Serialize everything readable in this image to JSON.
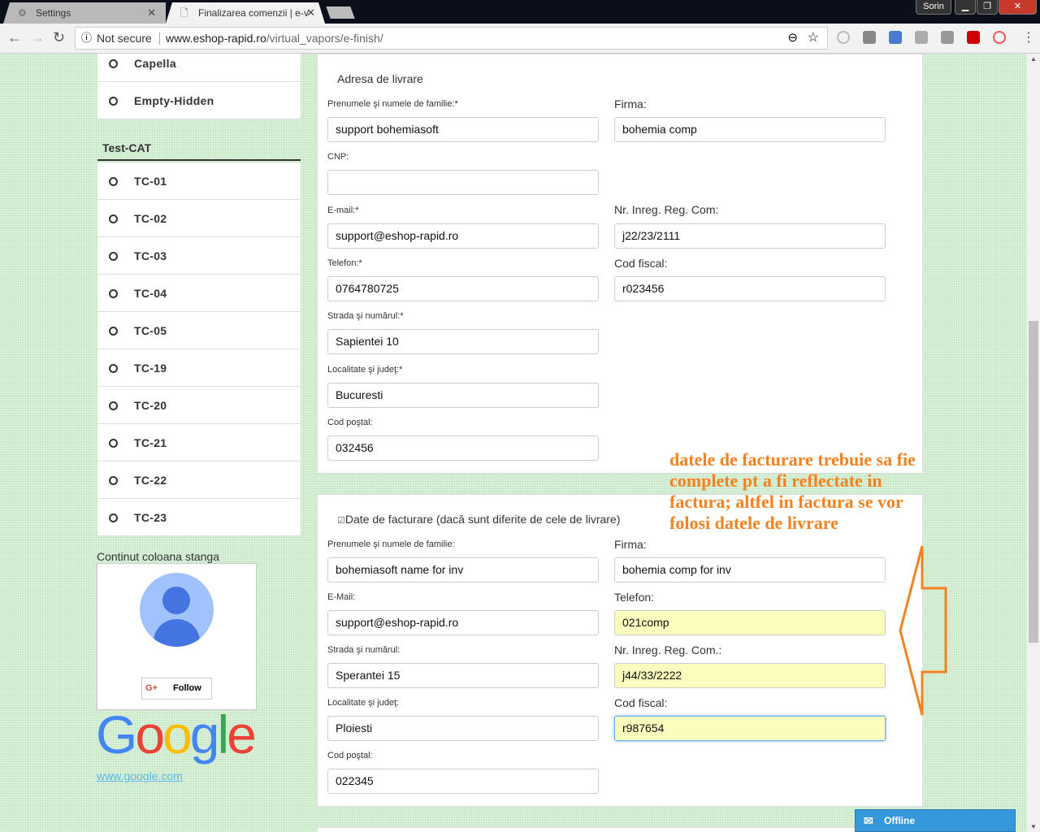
{
  "browser": {
    "tabs": [
      {
        "label": "Settings",
        "icon": "gear-icon"
      },
      {
        "label": "Finalizarea comenzii | e-v",
        "icon": "page-icon"
      }
    ],
    "user": "Sorin",
    "security": "Not secure",
    "url_host": "www.eshop-rapid.ro",
    "url_path": "/virtual_vapors/e-finish/"
  },
  "sidebar": {
    "top_items": [
      "Capella",
      "Empty-Hidden"
    ],
    "category": "Test-CAT",
    "items": [
      "TC-01",
      "TC-02",
      "TC-03",
      "TC-04",
      "TC-05",
      "TC-19",
      "TC-20",
      "TC-21",
      "TC-22",
      "TC-23"
    ],
    "widget_title": "Continut coloana stanga",
    "follow": "Follow",
    "google_logo": "Google",
    "google_link": "www.google.com"
  },
  "delivery": {
    "title": "Adresa de livrare",
    "name_label": "Prenumele şi numele de familie:*",
    "name": "support bohemiasoft",
    "company_label": "Firma:",
    "company": "bohemia comp",
    "cnp_label": "CNP:",
    "cnp": "",
    "email_label": "E-mail:*",
    "email": "support@eshop-rapid.ro",
    "reg_label": "Nr. Inreg. Reg. Com:",
    "reg": "j22/23/2111",
    "phone_label": "Telefon:*",
    "phone": "0764780725",
    "fiscal_label": "Cod fiscal:",
    "fiscal": "r023456",
    "street_label": "Strada şi numărul:*",
    "street": "Sapientei 10",
    "city_label": "Localitate şi judeţ:*",
    "city": "Bucuresti",
    "zip_label": "Cod poştal:",
    "zip": "032456"
  },
  "billing": {
    "checkbox_label": "Date de facturare (dacă sunt diferite de cele de livrare)",
    "checked": true,
    "name_label": "Prenumele şi numele de familie:",
    "name": "bohemiasoft name for inv",
    "company_label": "Firma:",
    "company": "bohemia comp for inv",
    "email_label": "E-Mail:",
    "email": "support@eshop-rapid.ro",
    "phone_label": "Telefon:",
    "phone": "021comp",
    "street_label": "Strada şi numărul:",
    "street": "Sperantei 15",
    "reg_label": "Nr. Inreg. Reg. Com.:",
    "reg": "j44/33/2222",
    "city_label": "Localitate şi judeţ:",
    "city": "Ploiesti",
    "fiscal_label": "Cod fiscal:",
    "fiscal": "r987654",
    "zip_label": "Cod poştal:",
    "zip": "022345"
  },
  "annotation": "datele de facturare trebuie sa fie complete pt a fi reflectate in factura; altfel in factura se vor folosi datele de livrare",
  "chat": {
    "label": "Offline",
    "icon": "envelope-icon"
  },
  "colors": {
    "annotation": "#f58220",
    "chat": "#3498db",
    "autofill": "#fbfdbe"
  }
}
